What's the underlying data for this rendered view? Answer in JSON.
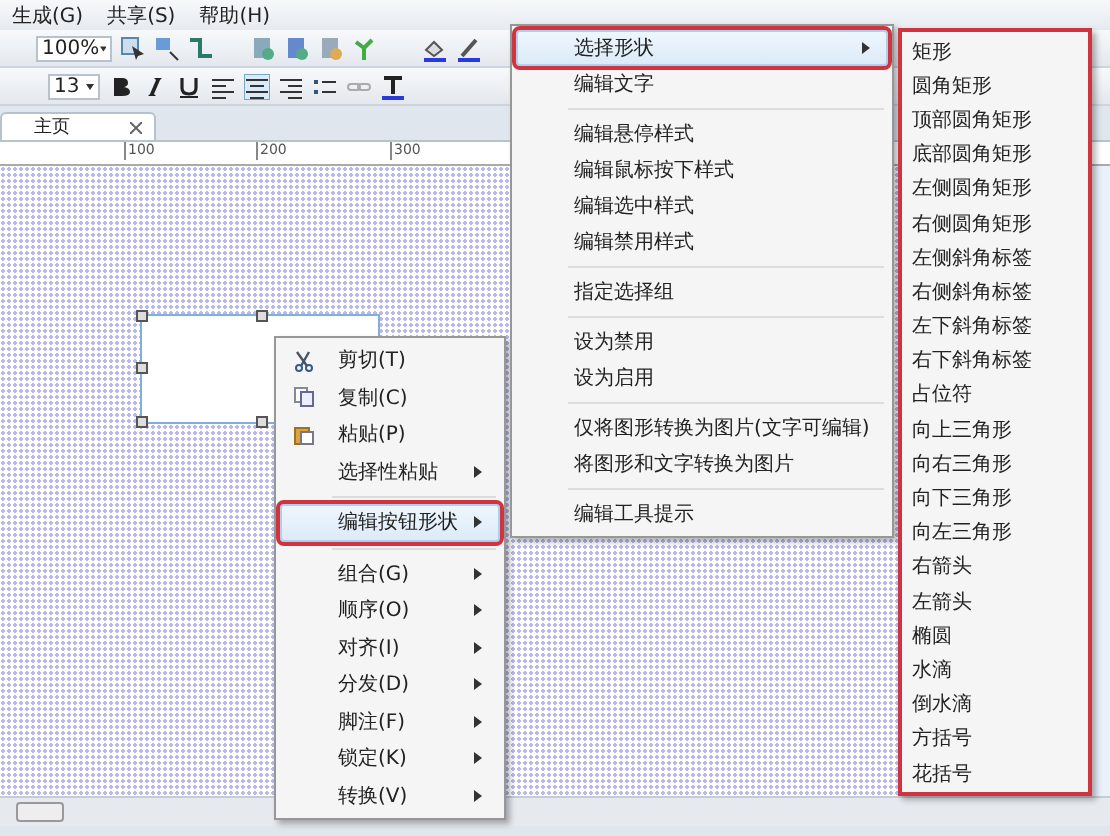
{
  "menubar": [
    "生成(G)",
    "共享(S)",
    "帮助(H)"
  ],
  "toolbar": {
    "zoom": "100%",
    "font_size": "13"
  },
  "tabs": [
    {
      "label": "主页",
      "selected": true
    }
  ],
  "ruler": [
    "100",
    "200",
    "300"
  ],
  "context_menu": {
    "items": [
      {
        "kind": "cut",
        "label": "剪切(T)",
        "submenu": false,
        "selected": false,
        "annotated": false
      },
      {
        "kind": "copy",
        "label": "复制(C)",
        "submenu": false,
        "selected": false,
        "annotated": false
      },
      {
        "kind": "paste",
        "label": "粘贴(P)",
        "submenu": false,
        "selected": false,
        "annotated": false
      },
      {
        "kind": "plain",
        "label": "选择性粘贴",
        "submenu": true,
        "selected": false,
        "annotated": false
      },
      {
        "kind": "separator"
      },
      {
        "kind": "plain",
        "label": "编辑按钮形状",
        "submenu": true,
        "selected": true,
        "annotated": true
      },
      {
        "kind": "separator"
      },
      {
        "kind": "plain",
        "label": "组合(G)",
        "submenu": true,
        "selected": false,
        "annotated": false
      },
      {
        "kind": "plain",
        "label": "顺序(O)",
        "submenu": true,
        "selected": false,
        "annotated": false
      },
      {
        "kind": "plain",
        "label": "对齐(I)",
        "submenu": true,
        "selected": false,
        "annotated": false
      },
      {
        "kind": "plain",
        "label": "分发(D)",
        "submenu": true,
        "selected": false,
        "annotated": false
      },
      {
        "kind": "plain",
        "label": "脚注(F)",
        "submenu": true,
        "selected": false,
        "annotated": false
      },
      {
        "kind": "plain",
        "label": "锁定(K)",
        "submenu": true,
        "selected": false,
        "annotated": false
      },
      {
        "kind": "plain",
        "label": "转换(V)",
        "submenu": true,
        "selected": false,
        "annotated": false
      }
    ]
  },
  "shape_menu": {
    "items": [
      {
        "kind": "plain",
        "label": "选择形状",
        "submenu": true,
        "selected": true,
        "annotated": true
      },
      {
        "kind": "plain",
        "label": "编辑文字",
        "submenu": false,
        "selected": false,
        "annotated": false
      },
      {
        "kind": "separator"
      },
      {
        "kind": "plain",
        "label": "编辑悬停样式",
        "submenu": false,
        "selected": false,
        "annotated": false
      },
      {
        "kind": "plain",
        "label": "编辑鼠标按下样式",
        "submenu": false,
        "selected": false,
        "annotated": false
      },
      {
        "kind": "plain",
        "label": "编辑选中样式",
        "submenu": false,
        "selected": false,
        "annotated": false
      },
      {
        "kind": "plain",
        "label": "编辑禁用样式",
        "submenu": false,
        "selected": false,
        "annotated": false
      },
      {
        "kind": "separator"
      },
      {
        "kind": "plain",
        "label": "指定选择组",
        "submenu": false,
        "selected": false,
        "annotated": false
      },
      {
        "kind": "separator"
      },
      {
        "kind": "plain",
        "label": "设为禁用",
        "submenu": false,
        "selected": false,
        "annotated": false
      },
      {
        "kind": "plain",
        "label": "设为启用",
        "submenu": false,
        "selected": false,
        "annotated": false
      },
      {
        "kind": "separator"
      },
      {
        "kind": "plain",
        "label": "仅将图形转换为图片(文字可编辑)",
        "submenu": false,
        "selected": false,
        "annotated": false
      },
      {
        "kind": "plain",
        "label": "将图形和文字转换为图片",
        "submenu": false,
        "selected": false,
        "annotated": false
      },
      {
        "kind": "separator"
      },
      {
        "kind": "plain",
        "label": "编辑工具提示",
        "submenu": false,
        "selected": false,
        "annotated": false
      }
    ]
  },
  "shape_list": {
    "annotated": true,
    "items": [
      "矩形",
      "圆角矩形",
      "顶部圆角矩形",
      "底部圆角矩形",
      "左侧圆角矩形",
      "右侧圆角矩形",
      "左侧斜角标签",
      "右侧斜角标签",
      "左下斜角标签",
      "右下斜角标签",
      "占位符",
      "向上三角形",
      "向右三角形",
      "向下三角形",
      "向左三角形",
      "右箭头",
      "左箭头",
      "椭圆",
      "水滴",
      "倒水滴",
      "方括号",
      "花括号"
    ]
  }
}
